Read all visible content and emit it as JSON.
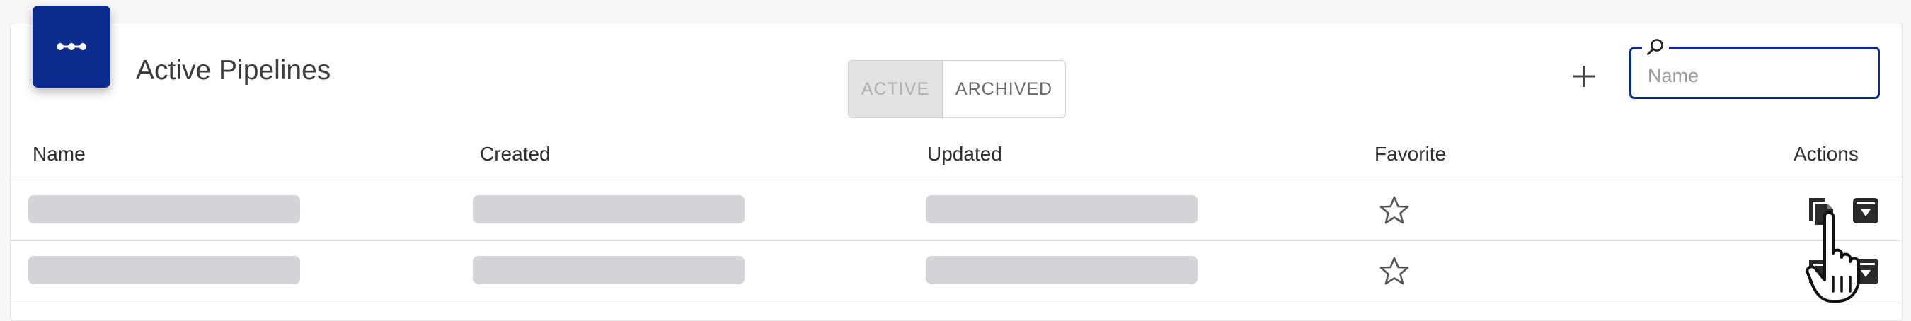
{
  "header": {
    "title": "Active Pipelines",
    "icon": "pipeline-icon",
    "accent_color": "#0d2b8f"
  },
  "toggle": {
    "active_label": "ACTIVE",
    "archived_label": "ARCHIVED",
    "selected": "ACTIVE"
  },
  "toolbar": {
    "add_icon": "plus-icon"
  },
  "search": {
    "placeholder": "Name",
    "value": "",
    "icon": "search-icon"
  },
  "table": {
    "columns": [
      "Name",
      "Created",
      "Updated",
      "Favorite",
      "Actions"
    ],
    "rows": [
      {
        "state": "loading",
        "favorite": false,
        "actions": [
          "duplicate-icon",
          "archive-icon"
        ]
      },
      {
        "state": "loading",
        "favorite": false,
        "actions": [
          "duplicate-icon",
          "archive-icon"
        ]
      }
    ]
  },
  "cursor": "hand-pointer-cursor"
}
